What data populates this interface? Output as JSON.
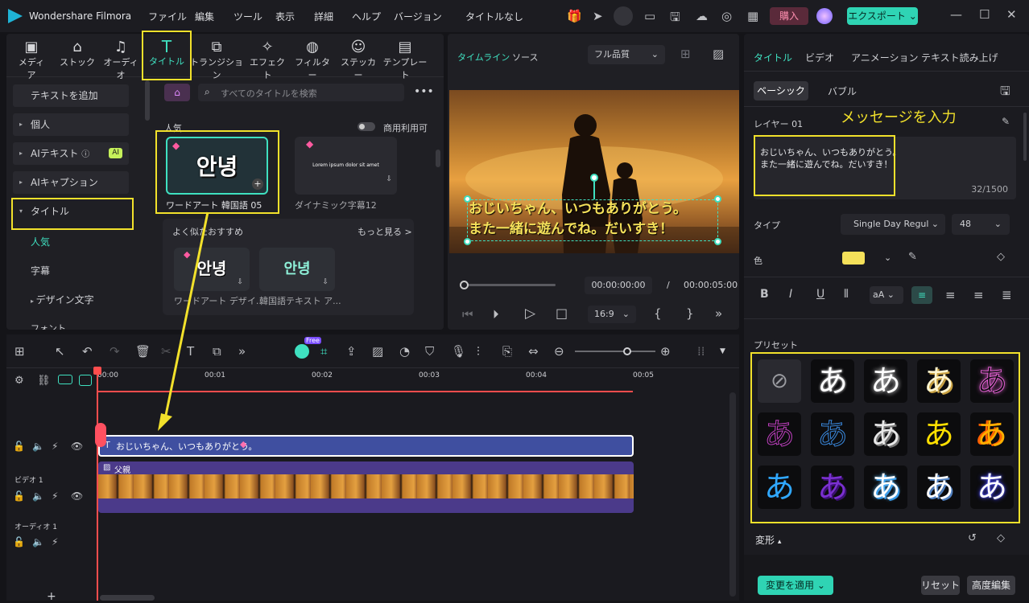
{
  "app": {
    "title": "Wondershare Filmora",
    "project": "タイトルなし"
  },
  "menu": [
    "ファイル",
    "編集",
    "ツール",
    "表示",
    "詳細",
    "ヘルプ",
    "バージョン"
  ],
  "top_buttons": {
    "buy": "購入",
    "export": "エクスポート"
  },
  "toolbar_tabs": [
    "メディア",
    "ストック",
    "オーディオ",
    "タイトル",
    "トランジション",
    "エフェクト",
    "フィルター",
    "ステッカー",
    "テンプレート"
  ],
  "toolbar_icons": [
    "media-icon",
    "stock-icon",
    "audio-icon",
    "title-icon",
    "transition-icon",
    "effect-icon",
    "filter-icon",
    "sticker-icon",
    "template-icon"
  ],
  "sidebar": {
    "add_text": "テキストを追加",
    "items": [
      "個人",
      "AIテキスト",
      "AIキャプション",
      "タイトル"
    ],
    "ai_badge": "AI",
    "sub": [
      "人気",
      "字幕",
      "デザイン文字",
      "フォント"
    ]
  },
  "library": {
    "search_placeholder": "すべてのタイトルを検索",
    "section": "人気",
    "commercial": "商用利用可",
    "items": [
      {
        "label": "ワードアート 韓国語 05",
        "thumb_text": "안녕"
      },
      {
        "label": "ダイナミック字幕12",
        "thumb_text": "Lorem ipsum dolor sit amet"
      }
    ],
    "similar_title": "よく似たおすすめ",
    "more": "もっと見る >",
    "similar": [
      {
        "label": "ワードアート デザイ...",
        "thumb_text": "안녕"
      },
      {
        "label": "韓国語テキスト ア...",
        "thumb_text": "안녕"
      }
    ]
  },
  "player": {
    "tab_timeline": "タイムライン",
    "tab_source": "ソース",
    "quality": "フル品質",
    "caption_line1": "おじいちゃん、いつもありがとう。",
    "caption_line2": "また一緒に遊んでね。だいすき！",
    "time_current": "00:00:00:00",
    "time_total": "00:00:05:00",
    "ratio": "16:9",
    "progress": 0
  },
  "timeline": {
    "ruler": [
      "00:00",
      "00:01",
      "00:02",
      "00:03",
      "00:04",
      "00:05"
    ],
    "title_clip": "おじいちゃん、いつもありがとう。",
    "video_clip": "父親",
    "track_video": "ビデオ 1",
    "track_audio": "オーディオ 1",
    "free_badge": "Free"
  },
  "right": {
    "tabs": [
      "タイトル",
      "ビデオ",
      "アニメーション",
      "テキスト読み上げ"
    ],
    "subtabs": [
      "ベーシック",
      "バブル"
    ],
    "layer": "レイヤー 01",
    "annotation": "メッセージを入力",
    "text_value": "おじいちゃん、いつもありがとう。\nまた一緒に遊んでね。だいすき！",
    "count": "32/1500",
    "type_label": "タイプ",
    "font": "Single Day Regul",
    "size": "48",
    "color_label": "色",
    "color": "#f5e15a",
    "preset_label": "プリセット",
    "transform_label": "変形",
    "apply": "変更を適用",
    "reset": "リセット",
    "advanced": "高度編集",
    "preset_glyph": "あ"
  },
  "colors": {
    "accent": "#3fe0c0",
    "highlight": "#f2e12b",
    "title_clip": "#3f4fa0",
    "video_track": "#4b3a8a",
    "playhead": "#ff4d4d"
  }
}
